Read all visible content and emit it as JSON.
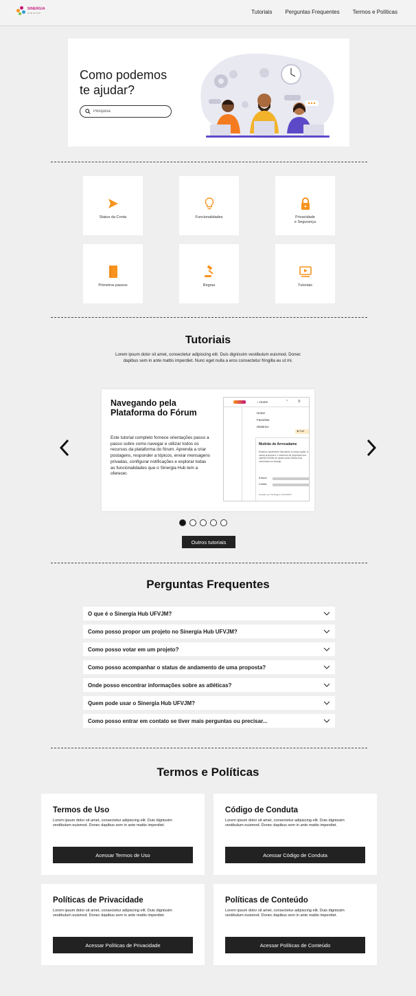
{
  "nav": {
    "logo_text": "SINERGIA",
    "logo_sub": "HUB UFVJM",
    "links": [
      "Tutoriais",
      "Perguntas Frequentes",
      "Termos e Políticas"
    ]
  },
  "hero": {
    "title": "Como podemos te ajudar?",
    "search_placeholder": "Pesquisa"
  },
  "categories": [
    {
      "label": "Status da Conta",
      "icon": "cursor-icon"
    },
    {
      "label": "Funcionalidades",
      "icon": "lightbulb-icon"
    },
    {
      "label": "Privacidade",
      "label2": "e Segurança",
      "icon": "lock-icon"
    },
    {
      "label": "Primeiros passos",
      "icon": "book-icon"
    },
    {
      "label": "Regras",
      "icon": "gavel-icon"
    },
    {
      "label": "Tutoriais",
      "icon": "video-icon"
    }
  ],
  "tutorials": {
    "title": "Tutoriais",
    "description": "Lorem ipsum dolor sit amet, consectetur adipiscing elit. Duis dignissim vestibulum euismod. Donec dapibus sem in ante mattis imperdiet. Nunc eget nulla a eros consectetur fringilla eu ut mi.",
    "slide": {
      "title": "Navegando pela Plataforma do Fórum",
      "text": "Este tutorial completo fornece orientações passo a passo sobre como navegar e utilizar todos os recursos da plataforma do fórum. Aprenda a criar postagens, responder a tópicos, enviar mensagens privadas, configurar notificações e explorar todas as funcionalidades que o Sinergia Hub tem a oferecer.",
      "preview": {
        "menu_home": "Home",
        "items": [
          "Home",
          "Favoritos",
          "Histórico"
        ],
        "badge": "Foll",
        "post_title": "Mutirão de Arrecadame",
        "post_text": "Estamos atualmente discutindo a nossa região. A causa proposta é o momento de expressar sua opinião mutirão de ajuda social. Basta clica comentário se desejar.",
        "a_favor": "A favor",
        "contra": "Contra",
        "footer": "Postado por Pia Bagner 10/11/2023"
      }
    },
    "dots_total": 5,
    "dots_active": 1,
    "more_button": "Outros tutoriais"
  },
  "faq": {
    "title": "Perguntas Frequentes",
    "questions": [
      "O que é o Sinergia Hub UFVJM?",
      "Como posso propor um projeto no Sinergia Hub UFVJM?",
      "Como posso votar em um projeto?",
      "Como posso acompanhar o status de andamento de uma proposta?",
      "Onde posso encontrar informações sobre as atléticas?",
      "Quem pode usar o Sinergia Hub UFVJM?",
      "Como posso entrar em contato se tiver mais perguntas ou precisar..."
    ]
  },
  "terms": {
    "title": "Termos e Políticas",
    "cards": [
      {
        "title": "Termos de Uso",
        "text": "Lorem ipsum dolor sit amet, consectetur adipiscing elit. Duis dignissim vestibulum euismod. Donec dapibus sem in ante mattis imperdiet.",
        "button": "Acessar Termos de Uso"
      },
      {
        "title": "Código de Conduta",
        "text": "Lorem ipsum dolor sit amet, consectetur adipiscing elit. Duis dignissim vestibulum euismod. Donec dapibus sem in ante mattis imperdiet.",
        "button": "Acessar Código de Conduta"
      },
      {
        "title": "Políticas de Privacidade",
        "text": "Lorem ipsum dolor sit amet, consectetur adipiscing elit. Duis dignissim vestibulum euismod. Donec dapibus sem in ante mattis imperdiet.",
        "button": "Acessar Políticas de Privacidade"
      },
      {
        "title": "Políticas de Conteúdo",
        "text": "Lorem ipsum dolor sit amet, consectetur adipiscing elit. Duis dignissim vestibulum euismod. Donec dapibus sem in ante mattis imperdiet.",
        "button": "Acessar Políticas de Conteúdo"
      }
    ]
  },
  "colors": {
    "accent": "#f7931e",
    "dark_button": "#222222",
    "background": "#efefef"
  }
}
